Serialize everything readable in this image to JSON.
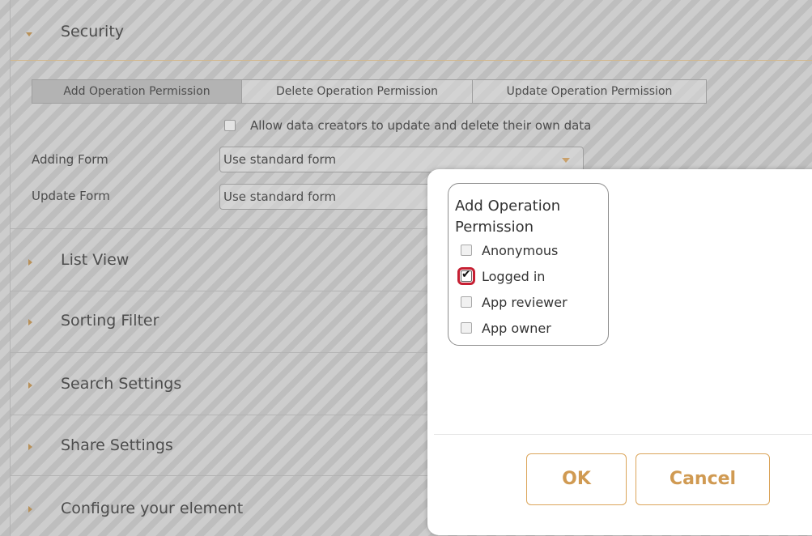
{
  "sections": {
    "security": {
      "title": "Security"
    },
    "list_view": {
      "title": "List View"
    },
    "sorting_filter": {
      "title": "Sorting Filter"
    },
    "search_settings": {
      "title": "Search Settings"
    },
    "share_settings": {
      "title": "Share Settings"
    },
    "configure_element": {
      "title": "Configure your element"
    }
  },
  "security": {
    "tabs": [
      {
        "label": "Add Operation Permission"
      },
      {
        "label": "Delete Operation Permission"
      },
      {
        "label": "Update Operation Permission"
      }
    ],
    "allow_label": "Allow data creators to update and delete their own data",
    "allow_checked": false,
    "adding_form": {
      "label": "Adding Form",
      "value": "Use standard form"
    },
    "update_form": {
      "label": "Update Form",
      "value": "Use standard form"
    }
  },
  "dialog": {
    "title": "Add Operation Permission",
    "options": [
      {
        "label": "Anonymous",
        "checked": false
      },
      {
        "label": "Logged in",
        "checked": true
      },
      {
        "label": "App reviewer",
        "checked": false
      },
      {
        "label": "App owner",
        "checked": false
      }
    ],
    "ok_label": "OK",
    "cancel_label": "Cancel"
  },
  "colors": {
    "accent": "#d09a52",
    "highlight": "#c62033",
    "arrow": "#b8915a"
  },
  "icons": {
    "expanded": "caret-down-icon",
    "collapsed": "caret-right-icon",
    "dropdown": "chevron-down-icon",
    "check": "checkmark-icon"
  }
}
